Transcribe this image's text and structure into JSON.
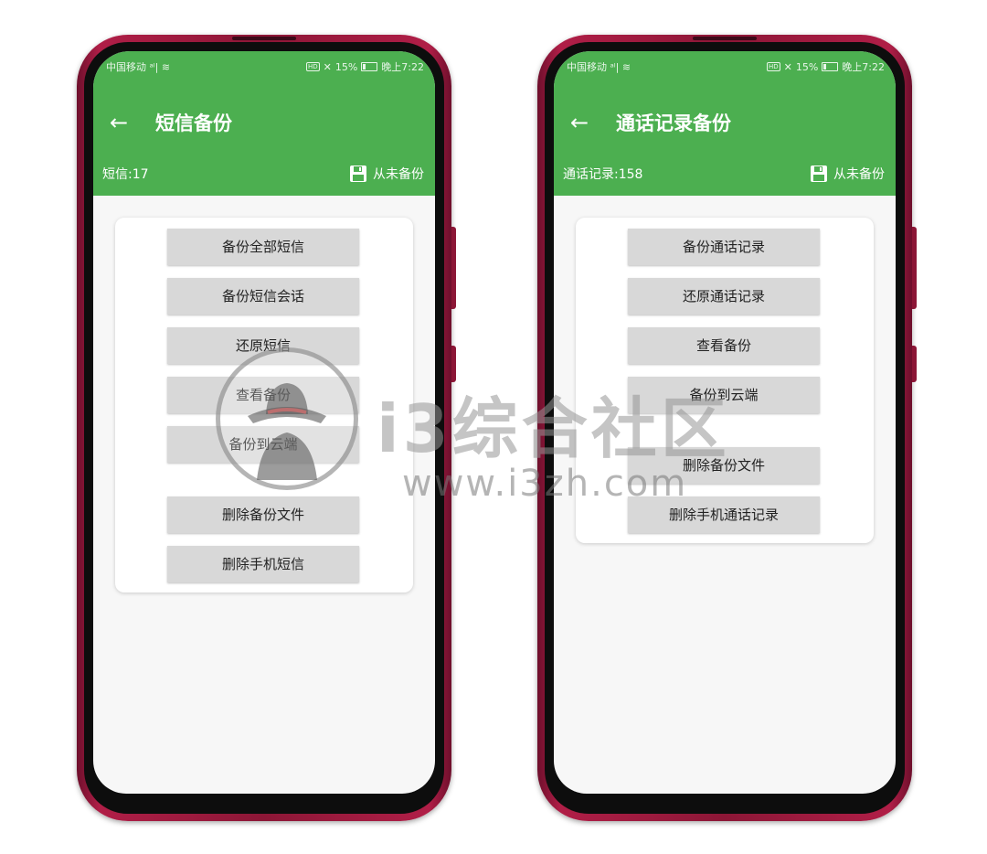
{
  "status": {
    "carrier": "中国移动",
    "right_text": "HD",
    "battery": "15%",
    "time": "晚上7:22"
  },
  "left_phone": {
    "title": "短信备份",
    "count_label": "短信:17",
    "backup_state": "从未备份",
    "buttons": [
      "备份全部短信",
      "备份短信会话",
      "还原短信",
      "查看备份",
      "备份到云端",
      "删除备份文件",
      "删除手机短信"
    ]
  },
  "right_phone": {
    "title": "通话记录备份",
    "count_label": "通话记录:158",
    "backup_state": "从未备份",
    "buttons": [
      "备份通话记录",
      "还原通话记录",
      "查看备份",
      "备份到云端",
      "删除备份文件",
      "删除手机通话记录"
    ]
  },
  "watermark": {
    "brand": "i3综合社区",
    "url": "www.i3zh.com"
  },
  "colors": {
    "header_green": "#4caf50",
    "phone_frame": "#8c1636",
    "button_gray": "#d8d8d8"
  }
}
